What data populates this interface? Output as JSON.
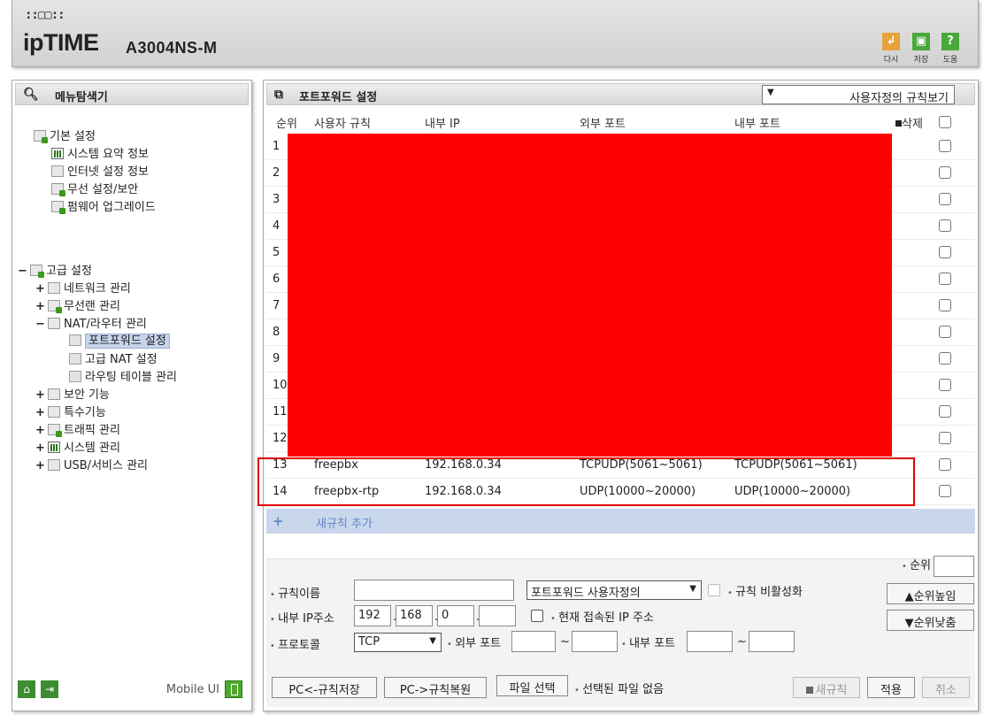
{
  "header": {
    "logo_dots": "::▢▢::",
    "brand": "ipTIME",
    "model": "A3004NS-M",
    "toolbar": [
      {
        "label": "다시",
        "icon": "refresh-icon",
        "color": "#e8a23a"
      },
      {
        "label": "저장",
        "icon": "save-icon",
        "color": "#4aa83a"
      },
      {
        "label": "도움",
        "icon": "help-icon",
        "color": "#4aa83a"
      }
    ]
  },
  "sidebar": {
    "title": "메뉴탐색기",
    "basic": {
      "label": "기본 설정",
      "items": [
        "시스템 요약 정보",
        "인터넷 설정 정보",
        "무선 설정/보안",
        "펌웨어 업그레이드"
      ]
    },
    "advanced": {
      "label": "고급 설정",
      "toggle": "−",
      "items": [
        {
          "toggle": "+",
          "label": "네트워크 관리"
        },
        {
          "toggle": "+",
          "label": "무선랜 관리"
        },
        {
          "toggle": "−",
          "label": "NAT/라우터 관리"
        },
        {
          "toggle": "+",
          "label": "보안 기능"
        },
        {
          "toggle": "+",
          "label": "특수기능"
        },
        {
          "toggle": "+",
          "label": "트래픽 관리"
        },
        {
          "toggle": "+",
          "label": "시스템 관리"
        },
        {
          "toggle": "+",
          "label": "USB/서비스 관리"
        }
      ],
      "nat_children": [
        "포트포워드 설정",
        "고급 NAT 설정",
        "라우팅 테이블 관리"
      ]
    },
    "mobile_ui": "Mobile UI"
  },
  "main": {
    "title": "포트포워드 설정",
    "view_select": "사용자정의 규칙보기",
    "columns": {
      "order": "순위",
      "rule": "사용자 규칙",
      "internal_ip": "내부 IP",
      "external_port": "외부 포트",
      "internal_port": "내부 포트",
      "delete": "삭제"
    },
    "rows": [
      {
        "n": "1"
      },
      {
        "n": "2"
      },
      {
        "n": "3"
      },
      {
        "n": "4"
      },
      {
        "n": "5"
      },
      {
        "n": "6"
      },
      {
        "n": "7"
      },
      {
        "n": "8"
      },
      {
        "n": "9"
      },
      {
        "n": "10"
      },
      {
        "n": "11"
      },
      {
        "n": "12"
      },
      {
        "n": "13",
        "rule": "freepbx",
        "ip": "192.168.0.34",
        "ext": "TCPUDP(5061~5061)",
        "int": "TCPUDP(5061~5061)"
      },
      {
        "n": "14",
        "rule": "freepbx-rtp",
        "ip": "192.168.0.34",
        "ext": "UDP(10000~20000)",
        "int": "UDP(10000~20000)"
      }
    ],
    "add_rule": "새규칙 추가",
    "redaction_color": "#ff0000"
  },
  "form": {
    "rule_name_label": "규칙이름",
    "rule_name_value": "",
    "rule_type": "포트포워드 사용자정의",
    "disable_rule": "규칙 비활성화",
    "ip_label": "내부 IP주소",
    "ip": [
      "192",
      "168",
      "0",
      ""
    ],
    "current_ip": "현재 접속된 IP 주소",
    "protocol_label": "프로토콜",
    "protocol": "TCP",
    "external_port_label": "외부 포트",
    "internal_port_label": "내부 포트",
    "tilde": "~",
    "order_label": "순위",
    "order_value": "",
    "up": "▲순위높임",
    "down": "▼순위낮춤"
  },
  "buttons": {
    "pc_save": "PC<-규칙저장",
    "pc_restore": "PC->규칙복원",
    "file_select": "파일 선택",
    "no_file": "선택된 파일 없음",
    "new_rule": "새규칙",
    "apply": "적용",
    "cancel": "취소"
  }
}
